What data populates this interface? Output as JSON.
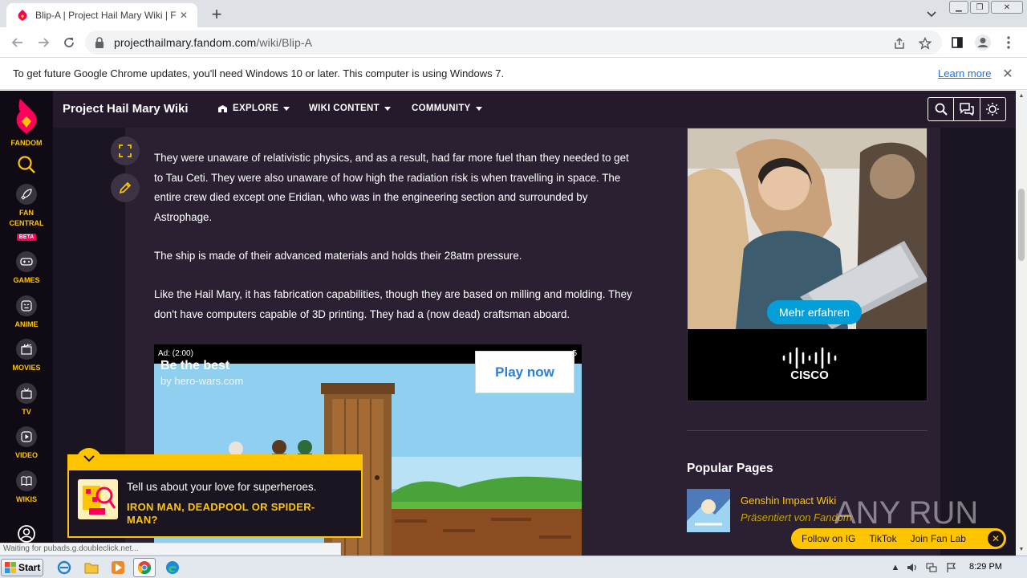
{
  "browser": {
    "tab_title": "Blip-A | Project Hail Mary Wiki | Fandom",
    "url_host": "projecthailmary.fandom.com",
    "url_path": "/wiki/Blip-A"
  },
  "infobar": {
    "message": "To get future Google Chrome updates, you'll need Windows 10 or later. This computer is using Windows 7.",
    "link": "Learn more"
  },
  "fandom_rail": {
    "logo_label": "FANDOM",
    "items": [
      {
        "label": "FAN CENTRAL",
        "badge": "BETA"
      },
      {
        "label": "GAMES"
      },
      {
        "label": "ANIME"
      },
      {
        "label": "MOVIES"
      },
      {
        "label": "TV"
      },
      {
        "label": "VIDEO"
      },
      {
        "label": "WIKIS"
      }
    ]
  },
  "wiki_header": {
    "name": "Project Hail Mary Wiki",
    "nav": [
      "EXPLORE",
      "WIKI CONTENT",
      "COMMUNITY"
    ]
  },
  "article": {
    "paragraphs": [
      "They were unaware of relativistic physics, and as a result, had far more fuel than they needed to get to Tau Ceti. They were also unaware of how high the radiation risk is when travelling in space. The entire crew died except one Eridian, who was in the engineering section and surrounded by Astrophage.",
      "The ship is made of their advanced materials and holds their 28atm pressure.",
      "Like the Hail Mary, it has fabrication capabilities, though they are based on milling and molding. They don't have computers capable of 3D printing. They had a (now dead) craftsman aboard."
    ]
  },
  "video_ad": {
    "timer": "Ad: (2:00)",
    "count": "5",
    "headline": "Be the best",
    "by": "by hero-wars.com",
    "cta": "Play now"
  },
  "side_ad": {
    "cta": "Mehr erfahren",
    "brand": "CISCO"
  },
  "popular_pages": {
    "title": "Popular Pages",
    "items": [
      {
        "title": "Genshin Impact Wiki",
        "subtitle": "Präsentiert von Fandom"
      }
    ]
  },
  "social": {
    "links": [
      "Follow on IG",
      "TikTok",
      "Join Fan Lab"
    ]
  },
  "quiz": {
    "question": "Tell us about your love for superheroes.",
    "answer": "IRON MAN, DEADPOOL OR SPIDER-MAN?"
  },
  "status_bar": "Waiting for pubads.g.doubleclick.net...",
  "watermark": "ANY RUN",
  "taskbar": {
    "start": "Start",
    "time": "8:29 PM"
  },
  "colors": {
    "fandom_yellow": "#ffc500",
    "fandom_pink": "#fa005a",
    "page_bg": "#2a2032",
    "header_bg": "#241a2c",
    "cisco_blue": "#049fd9"
  }
}
